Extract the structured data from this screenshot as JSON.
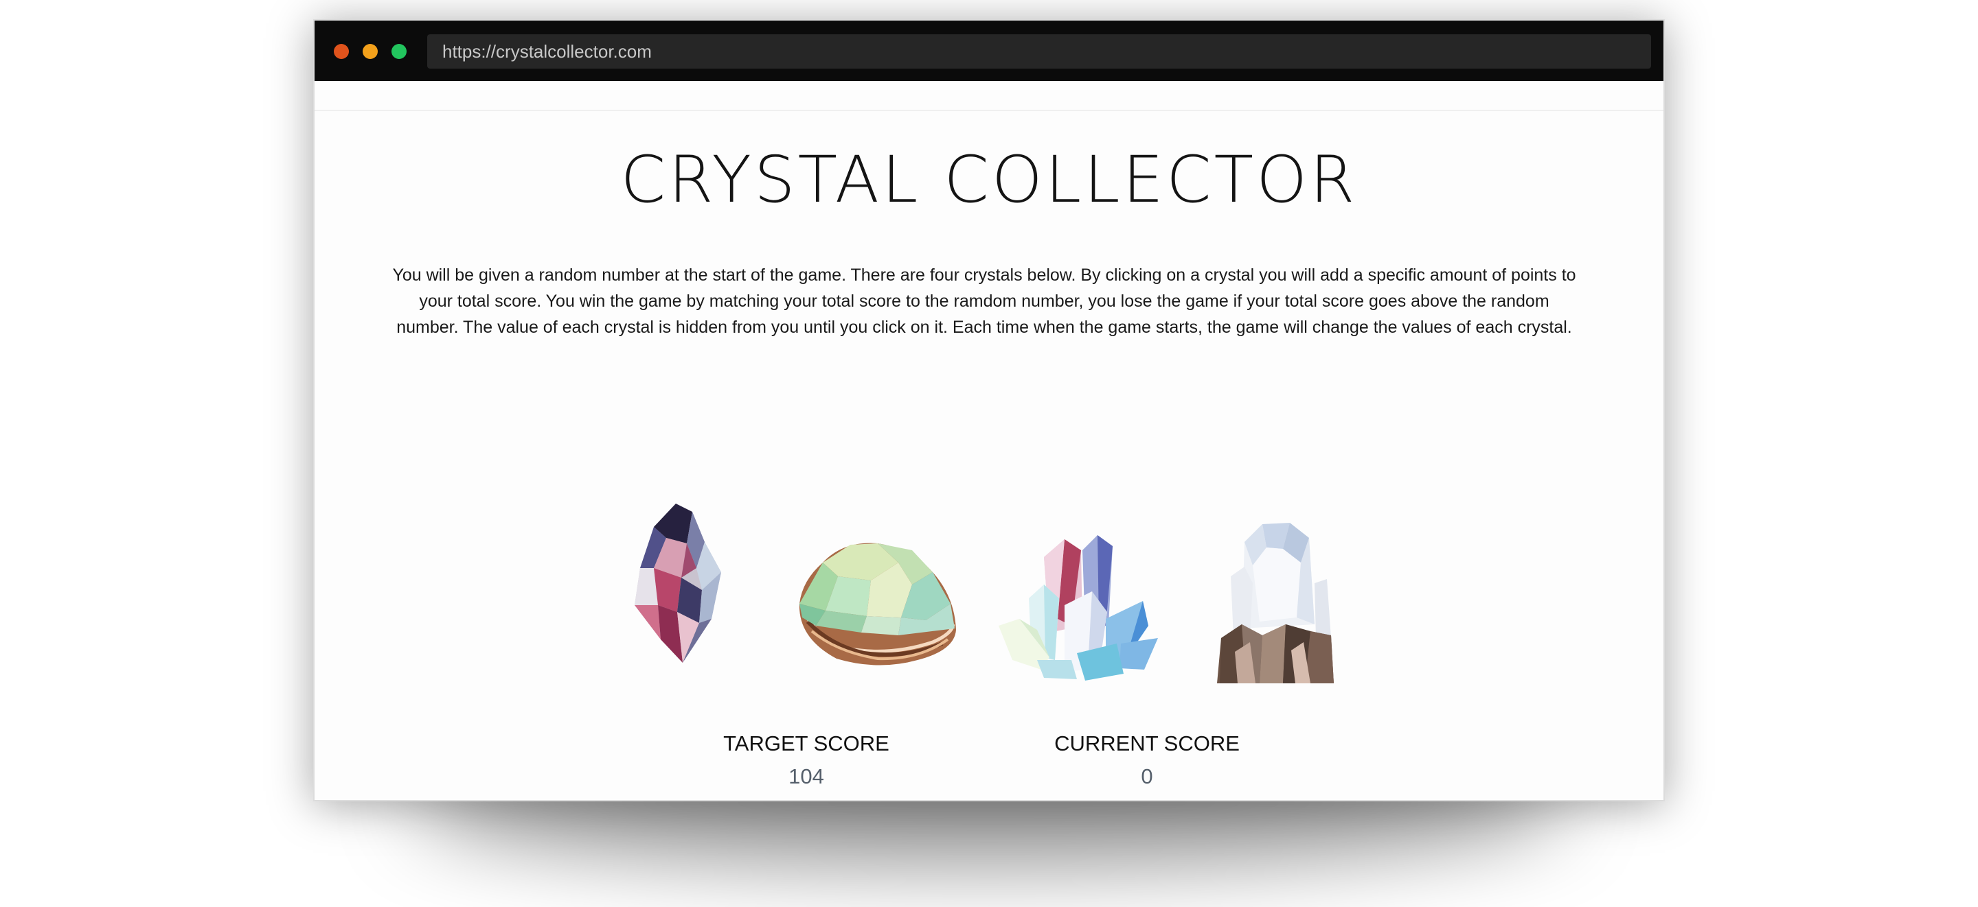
{
  "browser": {
    "url": "https://crystalcollector.com"
  },
  "header": {
    "title": "CRYSTAL COLLECTOR"
  },
  "instructions": {
    "text": "You will be given a random number at the start of the game. There are four crystals below. By clicking on a crystal you will add a specific amount of points to your total score. You win the game by matching your total score to the ramdom number, you lose the game if your total score goes above the random number. The value of each crystal is hidden from you until you click on it. Each time when the game starts, the game will change the values of each crystal."
  },
  "crystals": [
    {
      "icon": "pink-crystal-icon"
    },
    {
      "icon": "green-geode-icon"
    },
    {
      "icon": "crystal-cluster-icon"
    },
    {
      "icon": "white-quartz-icon"
    }
  ],
  "scores": {
    "target_label": "TARGET SCORE",
    "target_value": "104",
    "current_label": "CURRENT SCORE",
    "current_value": "0"
  },
  "colors": {
    "titlebar": "#0b0b0b",
    "dot_red": "#e0531c",
    "dot_yellow": "#f3a11b",
    "dot_green": "#22c55e"
  }
}
